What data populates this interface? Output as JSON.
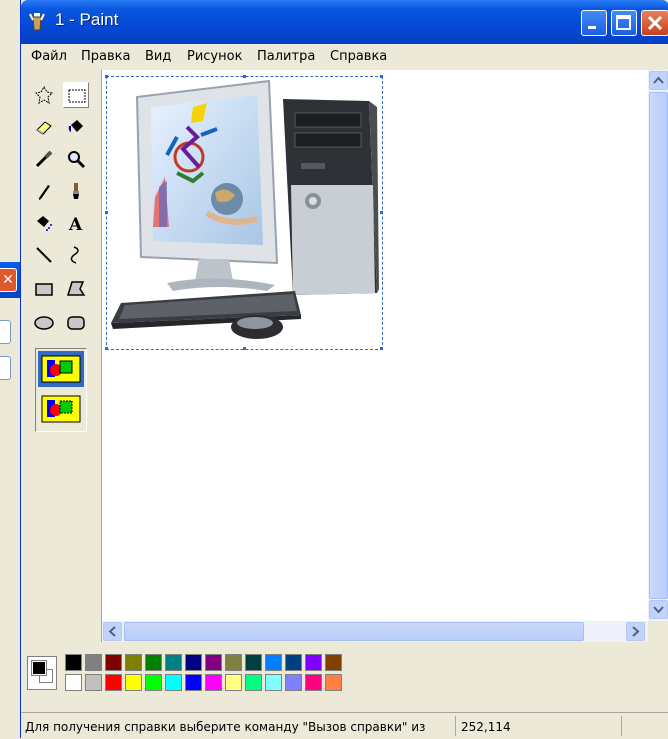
{
  "window": {
    "title": "1 - Paint",
    "accent": "#0a58e0"
  },
  "menu": {
    "items": [
      "Файл",
      "Правка",
      "Вид",
      "Рисунок",
      "Палитра",
      "Справка"
    ]
  },
  "toolbox": {
    "tools": [
      "free-select-icon",
      "rect-select-icon",
      "eraser-icon",
      "fill-icon",
      "picker-icon",
      "magnifier-icon",
      "pencil-icon",
      "brush-icon",
      "airbrush-icon",
      "text-icon",
      "line-icon",
      "curve-icon",
      "rectangle-icon",
      "polygon-icon",
      "ellipse-icon",
      "rounded-rect-icon"
    ],
    "selected": "rect-select-icon",
    "options": [
      "opaque-selection-icon",
      "transparent-selection-icon"
    ]
  },
  "palette": {
    "foreground": "#000000",
    "background": "#ffffff",
    "row1": [
      "#000000",
      "#808080",
      "#800000",
      "#808000",
      "#008000",
      "#008080",
      "#000080",
      "#800080",
      "#808040",
      "#004040",
      "#0080ff",
      "#004080",
      "#8000ff",
      "#804000"
    ],
    "row2": [
      "#ffffff",
      "#c0c0c0",
      "#ff0000",
      "#ffff00",
      "#00ff00",
      "#00ffff",
      "#0000ff",
      "#ff00ff",
      "#ffff80",
      "#00ff80",
      "#80ffff",
      "#8080ff",
      "#ff0080",
      "#ff8040"
    ]
  },
  "status": {
    "text": "Для получения справки выберите команду \"Вызов справки\" из",
    "coords": "252,114"
  }
}
